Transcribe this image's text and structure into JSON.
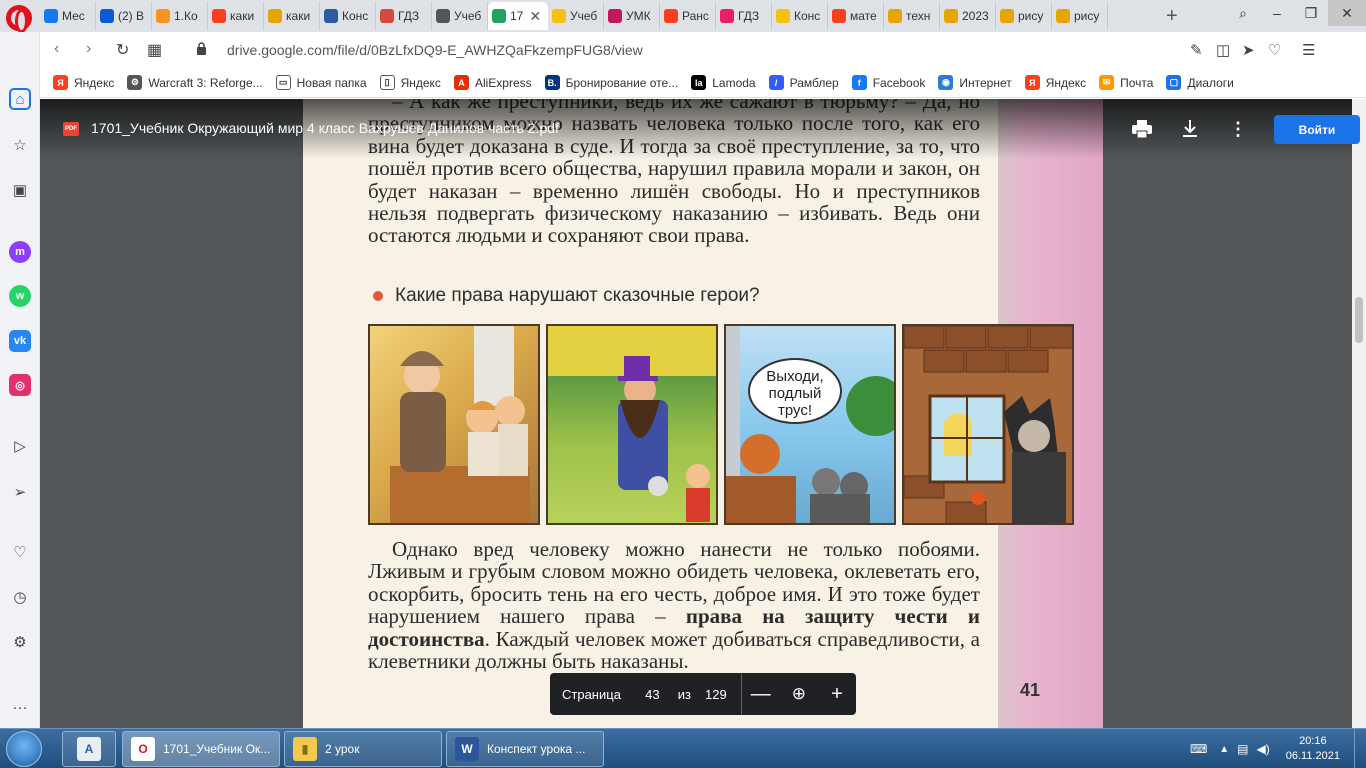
{
  "browser": {
    "tabs": [
      {
        "label": "Мес",
        "icon": "messenger-icon",
        "color": "#1877f2"
      },
      {
        "label": "(2) В",
        "icon": "mail-icon",
        "color": "#0a5bd3"
      },
      {
        "label": "1.Ко",
        "icon": "ok-icon",
        "color": "#f7931e"
      },
      {
        "label": "каки",
        "icon": "yandex-icon",
        "color": "#fc3f1d"
      },
      {
        "label": "каки",
        "icon": "image-icon",
        "color": "#e8a400"
      },
      {
        "label": "Конс",
        "icon": "book-icon",
        "color": "#2c5aa0"
      },
      {
        "label": "ГДЗ",
        "icon": "gdz-icon",
        "color": "#d84a3a"
      },
      {
        "label": "Учеб",
        "icon": "globe-icon",
        "color": "#555555"
      },
      {
        "label": "17",
        "icon": "drive-icon",
        "color": "#1fa463",
        "active": true
      },
      {
        "label": "Учеб",
        "icon": "doc-icon",
        "color": "#f4c20d"
      },
      {
        "label": "УМК",
        "icon": "umk-icon",
        "color": "#c2185b"
      },
      {
        "label": "Ранс",
        "icon": "yandex-icon",
        "color": "#fc3f1d"
      },
      {
        "label": "ГДЗ",
        "icon": "hand-icon",
        "color": "#e91e63"
      },
      {
        "label": "Конс",
        "icon": "doc-icon",
        "color": "#f4c20d"
      },
      {
        "label": "мате",
        "icon": "yandex-icon",
        "color": "#fc3f1d"
      },
      {
        "label": "техн",
        "icon": "image-icon",
        "color": "#e8a400"
      },
      {
        "label": "2023",
        "icon": "image-icon",
        "color": "#e8a400"
      },
      {
        "label": "рису",
        "icon": "image-icon",
        "color": "#e8a400"
      },
      {
        "label": "рису",
        "icon": "image-icon",
        "color": "#e8a400"
      }
    ],
    "url": "drive.google.com/file/d/0BzLfxDQ9-E_AWHZQaFkzempFUG8/view",
    "bookmarks": [
      {
        "label": "Яндекс",
        "icon": "yandex-icon",
        "color": "#fc3f1d",
        "glyph": "Я"
      },
      {
        "label": "Warcraft 3: Reforge...",
        "icon": "gear-icon",
        "color": "#555555",
        "glyph": "⚙"
      },
      {
        "label": "Новая папка",
        "icon": "folder-icon",
        "color": "#ffffff",
        "glyph": "▭"
      },
      {
        "label": "Яндекс",
        "icon": "doc-icon",
        "color": "#ffffff",
        "glyph": "▯"
      },
      {
        "label": "AliExpress",
        "icon": "aliexpress-icon",
        "color": "#e62e04",
        "glyph": "A"
      },
      {
        "label": "Бронирование оте...",
        "icon": "booking-icon",
        "color": "#003580",
        "glyph": "B."
      },
      {
        "label": "Lamoda",
        "icon": "lamoda-icon",
        "color": "#000000",
        "glyph": "la"
      },
      {
        "label": "Рамблер",
        "icon": "rambler-icon",
        "color": "#315efb",
        "glyph": "/"
      },
      {
        "label": "Facebook",
        "icon": "facebook-icon",
        "color": "#1877f2",
        "glyph": "f"
      },
      {
        "label": "Интернет",
        "icon": "globe-icon",
        "color": "#2a7fd4",
        "glyph": "◉"
      },
      {
        "label": "Яндекс",
        "icon": "yandex-icon",
        "color": "#fc3f1d",
        "glyph": "Я"
      },
      {
        "label": "Почта",
        "icon": "mail-icon",
        "color": "#ff9800",
        "glyph": "✉"
      },
      {
        "label": "Диалоги",
        "icon": "chat-icon",
        "color": "#1a73e8",
        "glyph": "▢"
      }
    ]
  },
  "drive": {
    "file_title": "1701_Учебник Окружающий мир 4 класс Вахрушев Данилов часть 2.pdf",
    "pdf_badge": "PDF",
    "open_button": "Войти",
    "page_label": "Страница",
    "current_page": "43",
    "of_label": "из",
    "total_pages": "129"
  },
  "document": {
    "para1": "– А как же преступники, ведь их же сажают в тюрьму? – Да, но преступником можно назвать человека только после того, как его вина будет доказана в суде. И тогда за своё преступление, за то, что пошёл против всего общества, нарушил правила морали и закон, он будет наказан – временно лишён свободы. Но и преступников нельзя подвергать физическому наказанию – избивать. Ведь они остаются людьми и сохраняют свои права.",
    "question": "Какие права нарушают сказочные герои?",
    "speech_bubble": "Выходи, подлый трус!",
    "para2_start": "Однако вред человеку можно нанести не только побоями. Лживым и грубым словом можно обидеть человека, оклеветать его, оскорбить, бросить тень на его честь, доброе имя. И это тоже будет нарушением нашего права – ",
    "para2_bold": "права на защиту чести и достоинства",
    "para2_end": ". Каждый человек может добиваться справедливости, а клеветники должны быть наказаны.",
    "page_number": "41"
  },
  "taskbar": {
    "apps": [
      {
        "label": "1701_Учебник Ок...",
        "icon": "opera-icon"
      },
      {
        "label": "2 урок",
        "icon": "folder-icon"
      },
      {
        "label": "Конспект урока ...",
        "icon": "word-icon"
      }
    ],
    "time": "20:16",
    "date": "06.11.2021"
  }
}
